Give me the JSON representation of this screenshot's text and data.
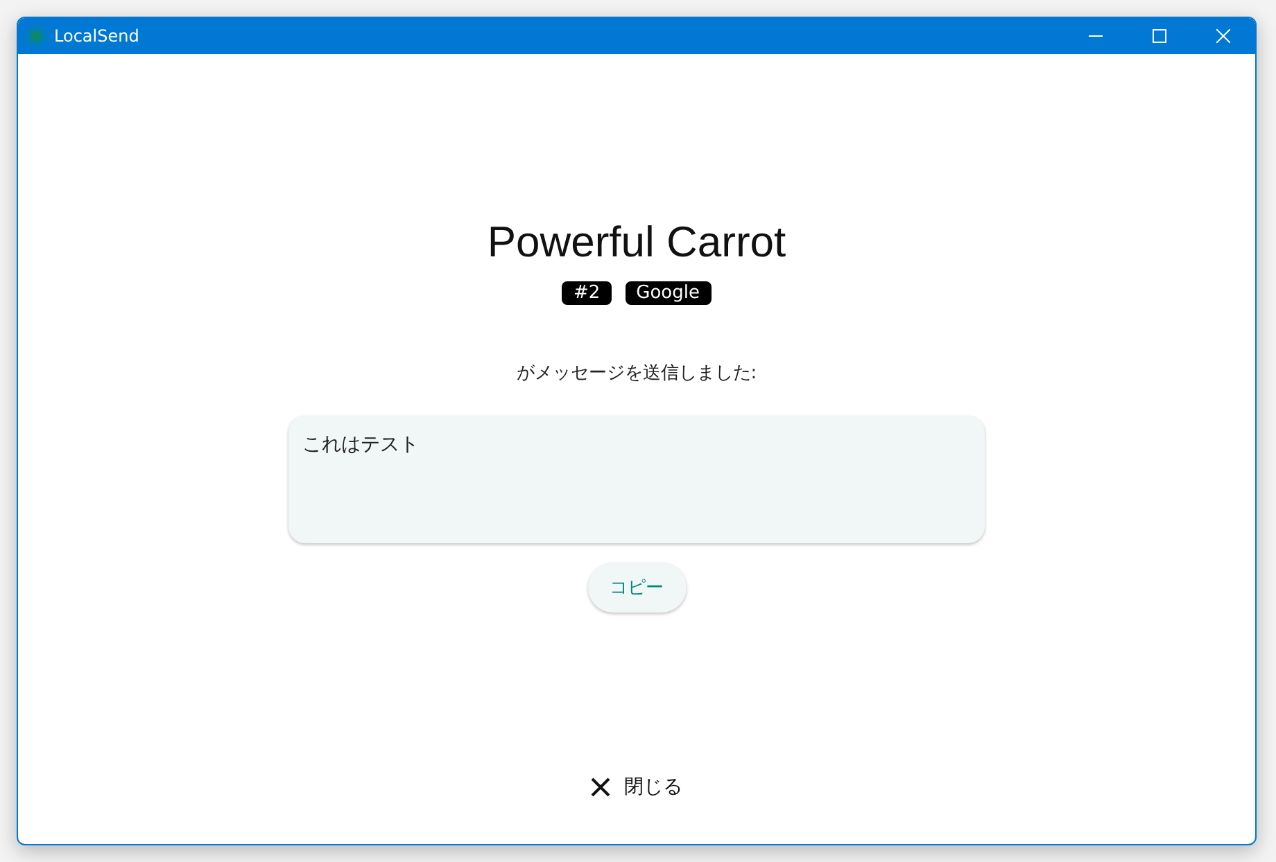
{
  "window": {
    "title": "LocalSend"
  },
  "sender": {
    "name": "Powerful Carrot",
    "tags": [
      "#2",
      "Google"
    ]
  },
  "caption": "がメッセージを送信しました:",
  "message": {
    "value": "これはテスト"
  },
  "copy_button": "コピー",
  "close_button": "閉じる"
}
